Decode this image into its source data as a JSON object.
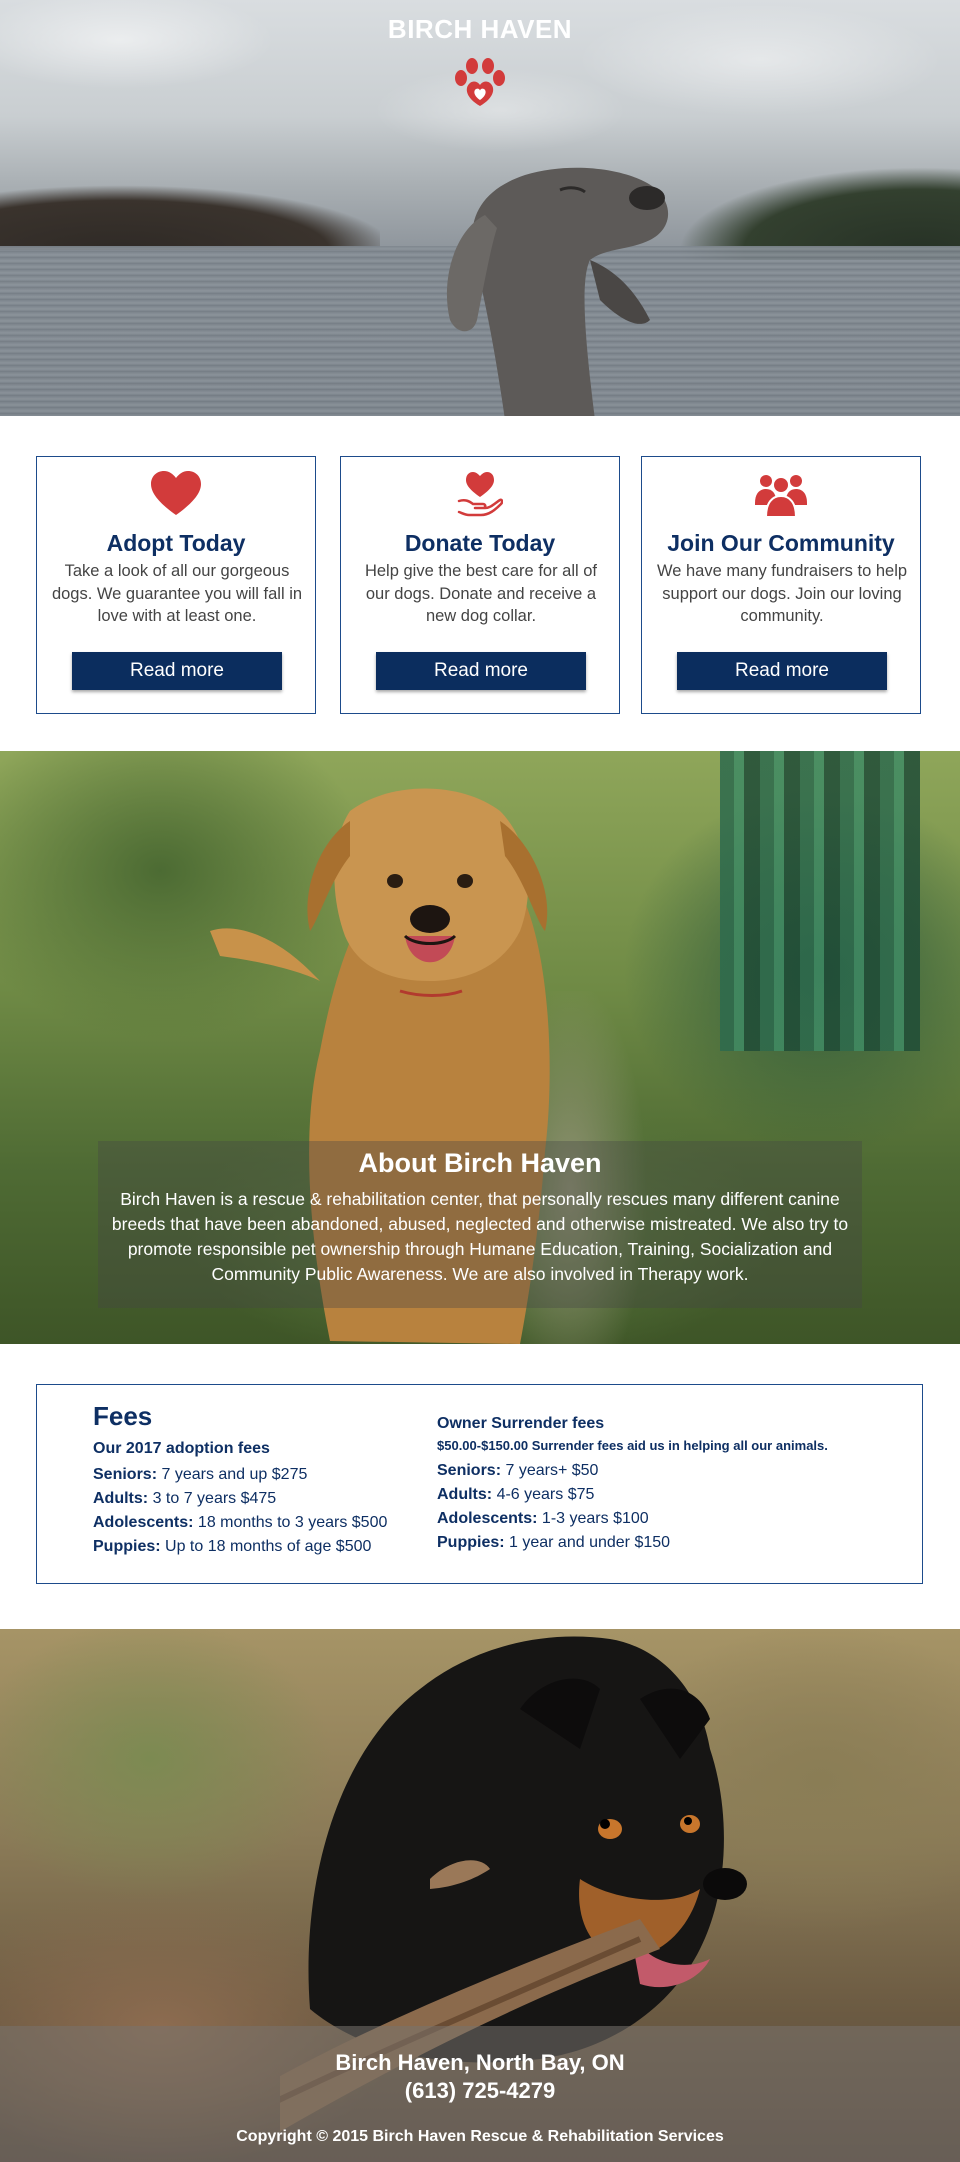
{
  "site": {
    "brand": "BIRCH HAVEN"
  },
  "colors": {
    "accent_red": "#d23b3b",
    "navy": "#0b2d5e",
    "heading_blue": "#0e2f63",
    "border_blue": "#1d4b8b"
  },
  "cards": [
    {
      "icon": "heart-icon",
      "title": "Adopt Today",
      "text": "Take a look of all our gorgeous dogs. We guarantee you will fall in love with at least one.",
      "button": "Read more"
    },
    {
      "icon": "heart-in-hand-icon",
      "title": "Donate Today",
      "text": "Help give the best care for all of our dogs. Donate and receive a new dog collar.",
      "button": "Read more"
    },
    {
      "icon": "people-icon",
      "title": "Join Our Community",
      "text": "We have many fundraisers to help support our dogs. Join our loving community.",
      "button": "Read more"
    }
  ],
  "about": {
    "title": "About Birch Haven",
    "text": "Birch Haven is a rescue & rehabilitation center, that personally rescues many different canine breeds that have been abandoned, abused, neglected and otherwise mistreated. We also try to promote responsible pet ownership through Humane Education, Training, Socialization and Community Public Awareness. We are also involved in Therapy work."
  },
  "fees": {
    "title": "Fees",
    "adoption": {
      "heading": "Our 2017 adoption fees",
      "rows": [
        {
          "label": "Seniors:",
          "value": "7 years and up $275"
        },
        {
          "label": "Adults:",
          "value": "3 to 7 years $475"
        },
        {
          "label": "Adolescents:",
          "value": "18 months to 3 years $500"
        },
        {
          "label": "Puppies:",
          "value": "Up to 18 months of age $500"
        }
      ]
    },
    "surrender": {
      "heading": "Owner Surrender fees",
      "note": "$50.00-$150.00 Surrender fees aid us in helping all our animals.",
      "rows": [
        {
          "label": "Seniors:",
          "value": "7 years+ $50"
        },
        {
          "label": "Adults:",
          "value": "4-6 years $75"
        },
        {
          "label": "Adolescents:",
          "value": "1-3 years $100"
        },
        {
          "label": "Puppies:",
          "value": "1 year and under $150"
        }
      ]
    }
  },
  "footer": {
    "place": "Birch Haven, North Bay, ON",
    "phone": "(613) 725-4279",
    "copyright": "Copyright © 2015 Birch Haven Rescue & Rehabilitation Services"
  }
}
